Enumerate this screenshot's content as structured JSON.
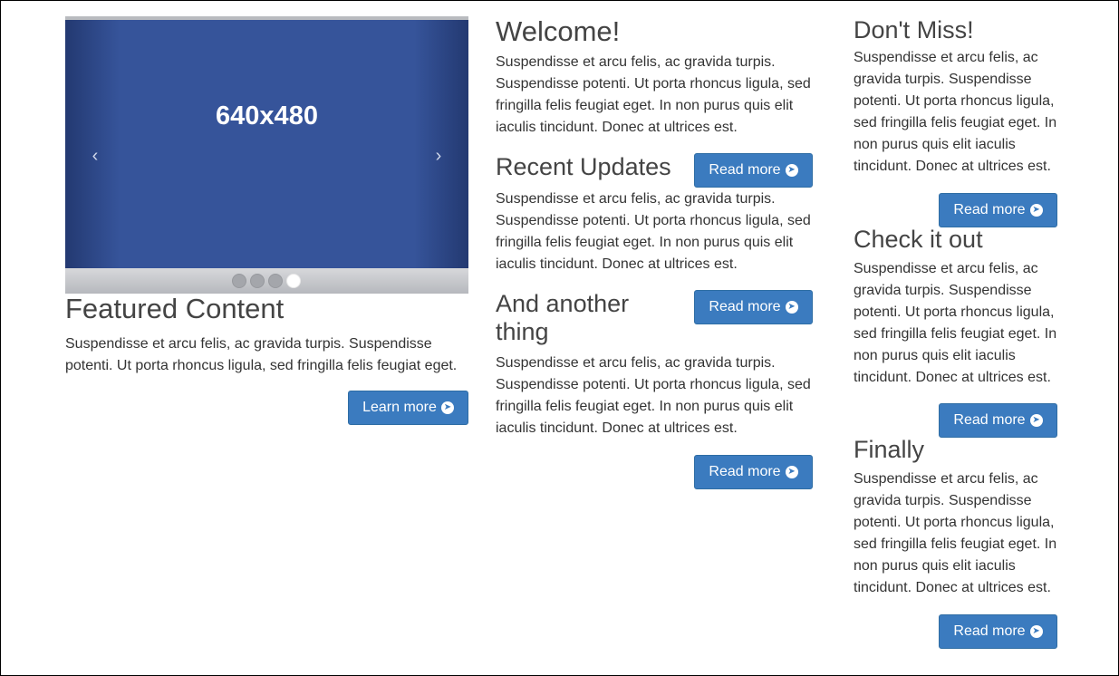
{
  "carousel": {
    "slide_label": "640x480",
    "prev_icon": "‹",
    "next_icon": "›",
    "indicator_count": 4,
    "active_index": 3
  },
  "featured": {
    "title": "Featured Content",
    "text": "Suspendisse et arcu felis, ac gravida turpis. Suspendisse potenti. Ut porta rhoncus ligula, sed fringilla felis feugiat eget.",
    "button_label": "Learn more",
    "button_icon": "arrow-circle-right-icon"
  },
  "middle": {
    "welcome": {
      "title": "Welcome!",
      "text": "Suspendisse et arcu felis, ac gravida turpis. Suspendisse potenti. Ut porta rhoncus ligula, sed fringilla felis feugiat eget. In non purus quis elit iaculis tincidunt. Donec at ultrices est."
    },
    "recent": {
      "title": "Recent Updates",
      "button_label": "Read more",
      "text": "Suspendisse et arcu felis, ac gravida turpis. Suspendisse potenti. Ut porta rhoncus ligula, sed fringilla felis feugiat eget. In non purus quis elit iaculis tincidunt. Donec at ultrices est."
    },
    "another": {
      "title": "And another thing",
      "button_label": "Read more",
      "text": "Suspendisse et arcu felis, ac gravida turpis. Suspendisse potenti. Ut porta rhoncus ligula, sed fringilla felis feugiat eget. In non purus quis elit iaculis tincidunt. Donec at ultrices est.",
      "bottom_button_label": "Read more"
    }
  },
  "right": {
    "dont_miss": {
      "title": "Don't Miss!",
      "text": "Suspendisse et arcu felis, ac gravida turpis. Suspendisse potenti. Ut porta rhoncus ligula, sed fringilla felis feugiat eget. In non purus quis elit iaculis tincidunt. Donec at ultrices est.",
      "button_label": "Read more"
    },
    "check_it_out": {
      "title": "Check it out",
      "text": "Suspendisse et arcu felis, ac gravida turpis. Suspendisse potenti. Ut porta rhoncus ligula, sed fringilla felis feugiat eget. In non purus quis elit iaculis tincidunt. Donec at ultrices est.",
      "button_label": "Read more"
    },
    "finally": {
      "title": "Finally",
      "text": "Suspendisse et arcu felis, ac gravida turpis. Suspendisse potenti. Ut porta rhoncus ligula, sed fringilla felis feugiat eget. In non purus quis elit iaculis tincidunt. Donec at ultrices est.",
      "button_label": "Read more"
    }
  },
  "colors": {
    "button_bg": "#3b7bbf",
    "slide_bg": "#36549a",
    "heading": "#444444",
    "body_text": "#333333"
  }
}
